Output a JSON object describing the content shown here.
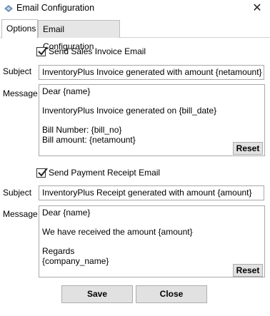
{
  "window": {
    "title": "Email Configuration",
    "close_glyph": "✕",
    "icon": "app-icon"
  },
  "tabs": [
    {
      "label": "Options",
      "active": true
    },
    {
      "label": "Email Configuration",
      "active": false
    }
  ],
  "sales_invoice": {
    "checkbox_label": "Send Sales Invoice Email",
    "checked": true,
    "subject_label": "Subject",
    "subject_value": "InventoryPlus Invoice generated with amount {netamount}",
    "message_label": "Message",
    "message_lines": [
      "Dear {name}",
      "",
      "InventoryPlus Invoice generated on {bill_date}",
      "",
      "Bill Number: {bill_no}",
      "Bill amount: {netamount}"
    ],
    "reset_label": "Reset"
  },
  "payment_receipt": {
    "checkbox_label": "Send Payment Receipt Email",
    "checked": true,
    "subject_label": "Subject",
    "subject_value": "InventoryPlus Receipt generated with amount {amount}",
    "message_label": "Message",
    "message_lines": [
      "Dear {name}",
      "",
      "We have received the amount {amount}",
      "",
      "Regards",
      "{company_name}"
    ],
    "reset_label": "Reset"
  },
  "footer": {
    "save_label": "Save",
    "close_label": "Close"
  }
}
